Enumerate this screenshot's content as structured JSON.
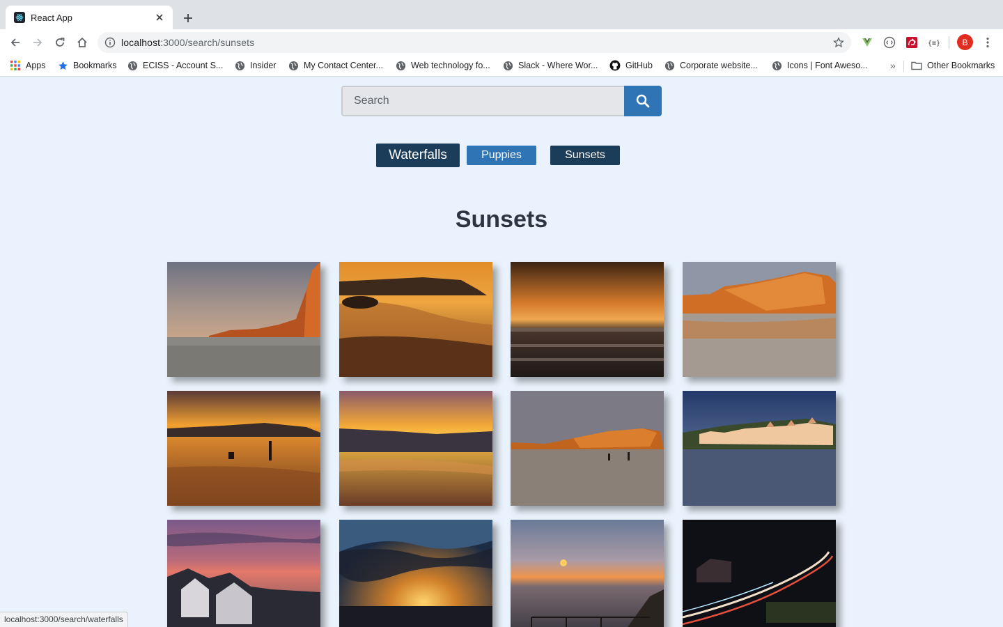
{
  "browser": {
    "tab_title": "React App",
    "url_host": "localhost",
    "url_path": ":3000/search/sunsets",
    "profile_initial": "B",
    "bookmarks": [
      {
        "label": "Apps",
        "icon": "apps-grid-icon"
      },
      {
        "label": "Bookmarks",
        "icon": "star-icon"
      },
      {
        "label": "ECISS - Account S...",
        "icon": "globe-icon"
      },
      {
        "label": "Insider",
        "icon": "globe-icon"
      },
      {
        "label": "My Contact Center...",
        "icon": "globe-icon"
      },
      {
        "label": "Web technology fo...",
        "icon": "globe-icon"
      },
      {
        "label": "Slack - Where Wor...",
        "icon": "globe-icon"
      },
      {
        "label": "GitHub",
        "icon": "github-icon"
      },
      {
        "label": "Corporate website...",
        "icon": "globe-icon"
      },
      {
        "label": "Icons | Font Aweso...",
        "icon": "globe-icon"
      }
    ],
    "overflow_label": "»",
    "other_bookmarks": "Other Bookmarks",
    "status_url": "localhost:3000/search/waterfalls"
  },
  "search": {
    "placeholder": "Search"
  },
  "categories": [
    {
      "label": "Waterfalls"
    },
    {
      "label": "Puppies"
    },
    {
      "label": "Sunsets"
    }
  ],
  "gallery": {
    "heading": "Sunsets",
    "photos": [
      {
        "name": "sunset-photo-cliff-beach"
      },
      {
        "name": "sunset-photo-headland-shore"
      },
      {
        "name": "sunset-photo-stormy-sea"
      },
      {
        "name": "sunset-photo-golden-cliffs"
      },
      {
        "name": "sunset-photo-fisherman"
      },
      {
        "name": "sunset-photo-horizon-beach"
      },
      {
        "name": "sunset-photo-beach-walkers"
      },
      {
        "name": "sunset-photo-seafront-houses"
      },
      {
        "name": "sunset-photo-purple-village"
      },
      {
        "name": "sunset-photo-sunburst-clouds"
      },
      {
        "name": "sunset-photo-coastal-path"
      },
      {
        "name": "sunset-photo-night-road"
      }
    ]
  },
  "colors": {
    "page_background": "#eaf3fd",
    "primary_dark": "#1c3d5a",
    "primary_blue": "#2f74b5",
    "heading": "#2b3642"
  }
}
